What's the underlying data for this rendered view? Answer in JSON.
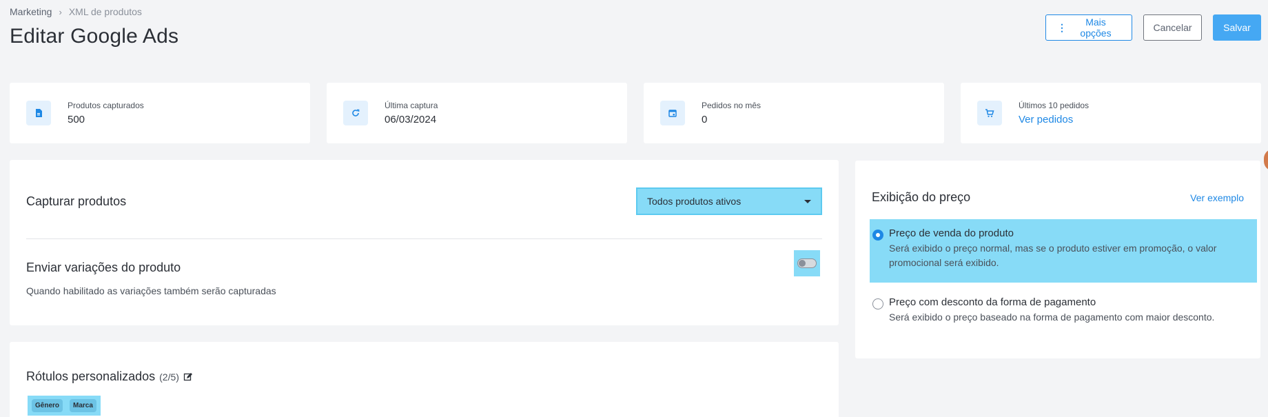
{
  "breadcrumb": {
    "parent": "Marketing",
    "separator": "›",
    "current": "XML de produtos"
  },
  "page": {
    "title": "Editar Google Ads"
  },
  "header_actions": {
    "more_options": "Mais opções",
    "cancel": "Cancelar",
    "save": "Salvar"
  },
  "stats": [
    {
      "label": "Produtos capturados",
      "value": "500",
      "icon": "document-icon"
    },
    {
      "label": "Última captura",
      "value": "06/03/2024",
      "icon": "refresh-icon"
    },
    {
      "label": "Pedidos no mês",
      "value": "0",
      "icon": "calendar-icon"
    },
    {
      "label": "Últimos 10 pedidos",
      "value": "Ver pedidos",
      "icon": "cart-icon"
    }
  ],
  "capture": {
    "title": "Capturar produtos",
    "select_value": "Todos produtos ativos",
    "variations_title": "Enviar variações do produto",
    "variations_desc": "Quando habilitado as variações também serão capturadas",
    "variations_enabled": false
  },
  "custom_labels": {
    "title": "Rótulos personalizados",
    "count": "(2/5)",
    "tags": [
      "Gênero",
      "Marca"
    ]
  },
  "price_display": {
    "title": "Exibição do preço",
    "example_link": "Ver exemplo",
    "options": [
      {
        "title": "Preço de venda do produto",
        "desc": "Será exibido o preço normal, mas se o produto estiver em promoção, o valor promocional será exibido.",
        "selected": true
      },
      {
        "title": "Preço com desconto da forma de pagamento",
        "desc": "Será exibido o preço baseado na forma de pagamento com maior desconto.",
        "selected": false
      }
    ]
  },
  "colors": {
    "accent": "#1e88e5",
    "primary_button": "#45a8f3",
    "highlight": "#87dbf7",
    "icon_bg": "#e4f1fd"
  }
}
